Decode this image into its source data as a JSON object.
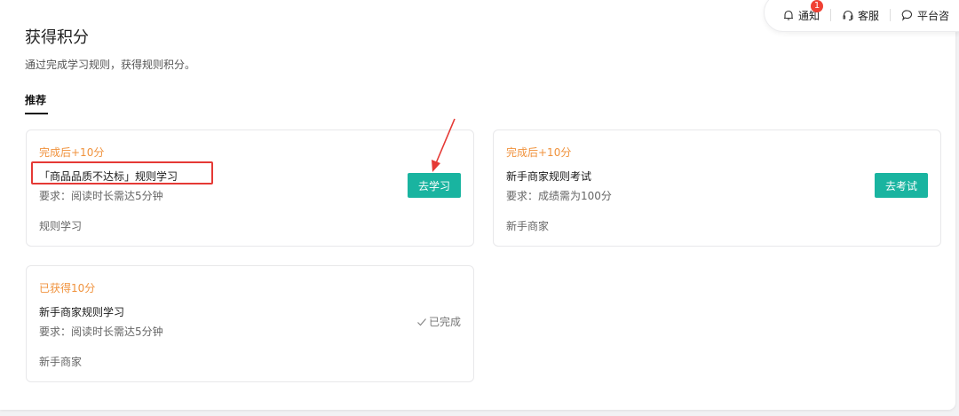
{
  "page": {
    "title": "获得积分",
    "subtitle": "通过完成学习规则，获得规则积分。",
    "tab": "推荐"
  },
  "topbar": {
    "notify_label": "通知",
    "notify_count": "1",
    "service_label": "客服",
    "platform_label": "平台咨"
  },
  "cards": [
    {
      "points": "完成后+10分",
      "name": "「商品品质不达标」规则学习",
      "requirement": "要求：阅读时长需达5分钟",
      "tag": "规则学习",
      "action": "去学习"
    },
    {
      "points": "完成后+10分",
      "name": "新手商家规则考试",
      "requirement": "要求：成绩需为100分",
      "tag": "新手商家",
      "action": "去考试"
    },
    {
      "points": "已获得10分",
      "name": "新手商家规则学习",
      "requirement": "要求：阅读时长需达5分钟",
      "tag": "新手商家",
      "status": "已完成"
    }
  ],
  "colors": {
    "accent": "#19b4a0",
    "points": "#f0923c",
    "highlight": "#e53935",
    "badge": "#f04134"
  }
}
